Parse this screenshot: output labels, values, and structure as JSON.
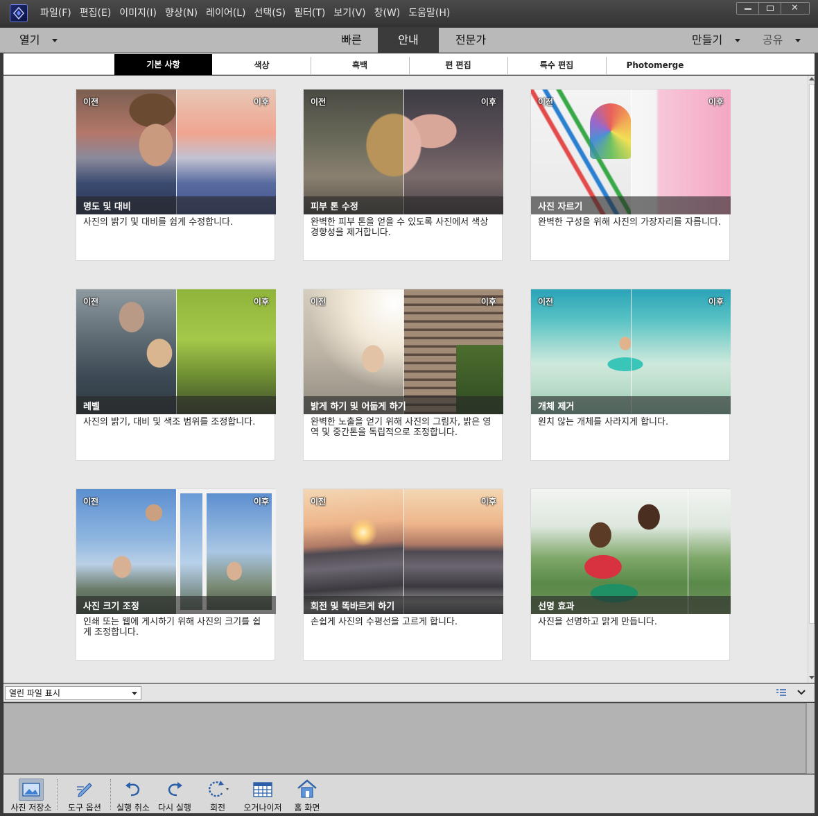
{
  "menu": [
    "파일(F)",
    "편집(E)",
    "이미지(I)",
    "향상(N)",
    "레이어(L)",
    "선택(S)",
    "필터(T)",
    "보기(V)",
    "창(W)",
    "도움말(H)"
  ],
  "modebar": {
    "open": "열기",
    "tabs": [
      "빠른",
      "안내",
      "전문가"
    ],
    "active_tab": "안내",
    "create": "만들기",
    "share": "공유"
  },
  "categories": [
    "기본 사항",
    "색상",
    "흑백",
    "편 편집",
    "특수 편집",
    "Photomerge"
  ],
  "active_category": "기본 사항",
  "card_labels": {
    "before": "이전",
    "after": "이후"
  },
  "cards": [
    {
      "title": "명도 및 대비",
      "desc": "사진의 밝기 및 대비를 쉽게 수정합니다."
    },
    {
      "title": "피부 톤 수정",
      "desc": "완벽한 피부 톤을 얻을 수 있도록 사진에서 색상 경향성을 제거합니다."
    },
    {
      "title": "사진 자르기",
      "desc": "완벽한 구성을 위해 사진의 가장자리를 자릅니다."
    },
    {
      "title": "레벨",
      "desc": "사진의 밝기, 대비 및 색조 범위를 조정합니다."
    },
    {
      "title": "밝게 하기 및 어둡게 하기",
      "desc": "완벽한 노출을 얻기 위해 사진의 그림자, 밝은 영역 및 중간톤을 독립적으로 조정합니다."
    },
    {
      "title": "개체 제거",
      "desc": "원치 않는 개체를 사라지게 합니다."
    },
    {
      "title": "사진 크기 조정",
      "desc": "인쇄 또는 웹에 게시하기 위해 사진의 크기를 쉽게 조정합니다."
    },
    {
      "title": "회전 및 똑바르게 하기",
      "desc": "손쉽게 사진의 수평선을 고르게 합니다."
    },
    {
      "title": "선명 효과",
      "desc": "사진을 선명하고 맑게 만듭니다."
    }
  ],
  "bin": {
    "select_value": "열린 파일 표시"
  },
  "toolbar": [
    "사진 저장소",
    "도구 옵션",
    "실행 취소",
    "다시 실행",
    "회전",
    "오거나이저",
    "홈 화면"
  ],
  "colors": {
    "active_tab_bg": "#3b3b3b",
    "category_active_bg": "#000000",
    "card_title_bar": "#282828"
  }
}
